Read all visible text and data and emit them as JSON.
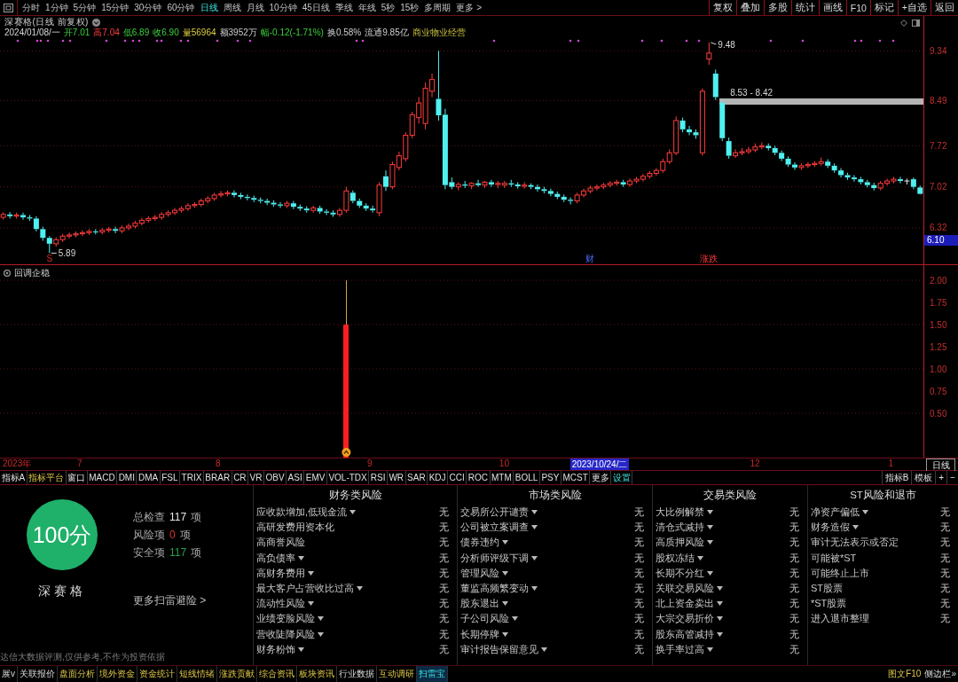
{
  "toolbar": {
    "periods": [
      {
        "label": "分时",
        "selected": false
      },
      {
        "label": "1分钟",
        "selected": false
      },
      {
        "label": "5分钟",
        "selected": false
      },
      {
        "label": "15分钟",
        "selected": false
      },
      {
        "label": "30分钟",
        "selected": false
      },
      {
        "label": "60分钟",
        "selected": false
      },
      {
        "label": "日线",
        "selected": true
      },
      {
        "label": "周线",
        "selected": false
      },
      {
        "label": "月线",
        "selected": false
      },
      {
        "label": "10分钟",
        "selected": false
      },
      {
        "label": "45日线",
        "selected": false
      },
      {
        "label": "季线",
        "selected": false
      },
      {
        "label": "年线",
        "selected": false
      },
      {
        "label": "5秒",
        "selected": false
      },
      {
        "label": "15秒",
        "selected": false
      },
      {
        "label": "多周期",
        "selected": false
      },
      {
        "label": "更多 >",
        "selected": false
      }
    ],
    "buttons": [
      "复权",
      "叠加",
      "多股",
      "统计",
      "画线",
      "F10",
      "标记",
      "+自选",
      "返回"
    ]
  },
  "stock_header": {
    "title": "深赛格(日线 前复权)",
    "date": "2024/01/08/一",
    "quotes": [
      {
        "text": "开7.01",
        "kind": "fall"
      },
      {
        "text": "高7.04",
        "kind": "rise"
      },
      {
        "text": "低6.89",
        "kind": "fall"
      },
      {
        "text": "收6.90",
        "kind": "fall"
      },
      {
        "text": "量56964",
        "kind": "volume"
      },
      {
        "text": "额3952万",
        "kind": "plain"
      },
      {
        "text": "幅-0.12(-1.71%)",
        "kind": "fall"
      },
      {
        "text": "换0.58%",
        "kind": "plain"
      },
      {
        "text": "流通9.85亿",
        "kind": "plain"
      },
      {
        "text": "商业物业经营",
        "kind": "industry"
      }
    ]
  },
  "price_chart": {
    "chart_data": [
      {
        "type": "candlestick",
        "ohlc": [
          [
            6.5,
            6.59,
            6.46,
            6.55
          ],
          [
            6.55,
            6.59,
            6.48,
            6.52
          ],
          [
            6.52,
            6.58,
            6.48,
            6.54
          ],
          [
            6.54,
            6.58,
            6.46,
            6.5
          ],
          [
            6.5,
            6.54,
            6.44,
            6.48
          ],
          [
            6.48,
            6.52,
            6.26,
            6.3
          ],
          [
            6.3,
            6.34,
            6.1,
            6.15
          ],
          [
            6.15,
            6.18,
            5.89,
            6.05
          ],
          [
            6.05,
            6.16,
            6.0,
            6.12
          ],
          [
            6.12,
            6.22,
            6.08,
            6.18
          ],
          [
            6.18,
            6.24,
            6.14,
            6.2
          ],
          [
            6.2,
            6.26,
            6.16,
            6.22
          ],
          [
            6.22,
            6.28,
            6.18,
            6.24
          ],
          [
            6.24,
            6.3,
            6.2,
            6.26
          ],
          [
            6.26,
            6.3,
            6.21,
            6.25
          ],
          [
            6.25,
            6.32,
            6.21,
            6.28
          ],
          [
            6.28,
            6.34,
            6.24,
            6.3
          ],
          [
            6.3,
            6.34,
            6.23,
            6.27
          ],
          [
            6.27,
            6.36,
            6.23,
            6.32
          ],
          [
            6.32,
            6.39,
            6.28,
            6.35
          ],
          [
            6.35,
            6.44,
            6.31,
            6.4
          ],
          [
            6.4,
            6.49,
            6.36,
            6.45
          ],
          [
            6.45,
            6.52,
            6.41,
            6.48
          ],
          [
            6.48,
            6.54,
            6.44,
            6.5
          ],
          [
            6.5,
            6.59,
            6.46,
            6.55
          ],
          [
            6.55,
            6.62,
            6.51,
            6.58
          ],
          [
            6.58,
            6.66,
            6.54,
            6.62
          ],
          [
            6.62,
            6.69,
            6.58,
            6.65
          ],
          [
            6.65,
            6.74,
            6.61,
            6.7
          ],
          [
            6.7,
            6.76,
            6.66,
            6.72
          ],
          [
            6.72,
            6.82,
            6.68,
            6.78
          ],
          [
            6.78,
            6.86,
            6.74,
            6.82
          ],
          [
            6.82,
            6.92,
            6.78,
            6.88
          ],
          [
            6.88,
            6.95,
            6.84,
            6.9
          ],
          [
            6.9,
            6.96,
            6.86,
            6.92
          ],
          [
            6.92,
            6.96,
            6.84,
            6.88
          ],
          [
            6.88,
            6.92,
            6.81,
            6.85
          ],
          [
            6.85,
            6.89,
            6.79,
            6.83
          ],
          [
            6.83,
            6.87,
            6.76,
            6.8
          ],
          [
            6.8,
            6.84,
            6.74,
            6.78
          ],
          [
            6.78,
            6.82,
            6.71,
            6.75
          ],
          [
            6.75,
            6.79,
            6.68,
            6.72
          ],
          [
            6.72,
            6.76,
            6.66,
            6.7
          ],
          [
            6.7,
            6.78,
            6.66,
            6.74
          ],
          [
            6.74,
            6.78,
            6.64,
            6.68
          ],
          [
            6.68,
            6.72,
            6.61,
            6.65
          ],
          [
            6.65,
            6.69,
            6.58,
            6.62
          ],
          [
            6.62,
            6.7,
            6.58,
            6.66
          ],
          [
            6.66,
            6.7,
            6.56,
            6.6
          ],
          [
            6.6,
            6.64,
            6.54,
            6.58
          ],
          [
            6.58,
            6.62,
            6.51,
            6.55
          ],
          [
            6.55,
            6.66,
            6.51,
            6.62
          ],
          [
            6.62,
            7.02,
            6.58,
            6.95
          ],
          [
            6.92,
            6.96,
            6.74,
            6.78
          ],
          [
            6.78,
            6.82,
            6.66,
            6.7
          ],
          [
            6.7,
            6.74,
            6.61,
            6.65
          ],
          [
            6.65,
            6.7,
            6.58,
            6.62
          ],
          [
            6.58,
            7.1,
            6.52,
            7.05
          ],
          [
            7.2,
            7.3,
            6.95,
            7.02
          ],
          [
            7.02,
            7.45,
            6.98,
            7.4
          ],
          [
            7.35,
            7.62,
            7.3,
            7.55
          ],
          [
            7.5,
            7.95,
            7.45,
            7.9
          ],
          [
            7.9,
            8.3,
            7.85,
            8.25
          ],
          [
            8.2,
            8.55,
            8.1,
            8.45
          ],
          [
            8.1,
            8.8,
            8.0,
            8.7
          ],
          [
            8.65,
            8.95,
            8.55,
            8.85
          ],
          [
            8.52,
            9.34,
            8.15,
            8.24
          ],
          [
            8.25,
            8.35,
            6.98,
            7.05
          ],
          [
            7.1,
            7.18,
            6.98,
            7.02
          ],
          [
            7.02,
            7.1,
            6.96,
            7.06
          ],
          [
            7.06,
            7.12,
            7.0,
            7.04
          ],
          [
            7.04,
            7.1,
            6.98,
            7.08
          ],
          [
            7.08,
            7.14,
            7.02,
            7.05
          ],
          [
            7.05,
            7.12,
            7.0,
            7.1
          ],
          [
            7.1,
            7.14,
            7.02,
            7.06
          ],
          [
            7.06,
            7.12,
            7.0,
            7.08
          ],
          [
            7.05,
            7.12,
            7.0,
            7.08
          ],
          [
            7.08,
            7.14,
            7.02,
            7.06
          ],
          [
            7.06,
            7.1,
            6.99,
            7.03
          ],
          [
            7.03,
            7.1,
            6.99,
            7.05
          ],
          [
            7.05,
            7.08,
            6.98,
            7.02
          ],
          [
            7.02,
            7.06,
            6.94,
            6.98
          ],
          [
            6.98,
            7.02,
            6.91,
            6.95
          ],
          [
            6.95,
            6.99,
            6.86,
            6.9
          ],
          [
            6.9,
            6.94,
            6.81,
            6.85
          ],
          [
            6.85,
            6.89,
            6.76,
            6.8
          ],
          [
            6.8,
            6.84,
            6.72,
            6.78
          ],
          [
            6.78,
            6.92,
            6.74,
            6.88
          ],
          [
            6.88,
            6.99,
            6.84,
            6.95
          ],
          [
            6.95,
            7.04,
            6.91,
            7.0
          ],
          [
            7.0,
            7.06,
            6.96,
            7.02
          ],
          [
            7.02,
            7.09,
            6.98,
            7.05
          ],
          [
            7.05,
            7.12,
            7.01,
            7.08
          ],
          [
            7.08,
            7.14,
            7.04,
            7.1
          ],
          [
            7.1,
            7.14,
            7.02,
            7.06
          ],
          [
            7.06,
            7.16,
            7.02,
            7.12
          ],
          [
            7.12,
            7.19,
            7.08,
            7.15
          ],
          [
            7.15,
            7.24,
            7.11,
            7.2
          ],
          [
            7.2,
            7.29,
            7.16,
            7.25
          ],
          [
            7.25,
            7.34,
            7.21,
            7.3
          ],
          [
            7.3,
            7.5,
            7.26,
            7.45
          ],
          [
            7.45,
            7.66,
            7.41,
            7.6
          ],
          [
            7.6,
            8.22,
            7.56,
            8.15
          ],
          [
            8.15,
            8.2,
            7.95,
            8.0
          ],
          [
            8.0,
            8.06,
            7.9,
            7.95
          ],
          [
            7.95,
            8.0,
            7.84,
            7.9
          ],
          [
            7.6,
            8.7,
            7.55,
            8.65
          ],
          [
            9.2,
            9.48,
            9.1,
            9.3
          ],
          [
            8.95,
            9.02,
            8.5,
            8.55
          ],
          [
            8.45,
            8.5,
            7.8,
            7.85
          ],
          [
            7.8,
            7.86,
            7.5,
            7.55
          ],
          [
            7.55,
            7.66,
            7.51,
            7.6
          ],
          [
            7.6,
            7.68,
            7.56,
            7.62
          ],
          [
            7.62,
            7.7,
            7.58,
            7.65
          ],
          [
            7.65,
            7.76,
            7.61,
            7.7
          ],
          [
            7.7,
            7.78,
            7.66,
            7.72
          ],
          [
            7.72,
            7.76,
            7.64,
            7.68
          ],
          [
            7.68,
            7.72,
            7.56,
            7.6
          ],
          [
            7.6,
            7.64,
            7.46,
            7.5
          ],
          [
            7.5,
            7.54,
            7.36,
            7.4
          ],
          [
            7.4,
            7.44,
            7.31,
            7.35
          ],
          [
            7.35,
            7.42,
            7.31,
            7.38
          ],
          [
            7.38,
            7.44,
            7.34,
            7.4
          ],
          [
            7.4,
            7.46,
            7.36,
            7.42
          ],
          [
            7.42,
            7.52,
            7.38,
            7.45
          ],
          [
            7.45,
            7.49,
            7.34,
            7.38
          ],
          [
            7.38,
            7.42,
            7.26,
            7.3
          ],
          [
            7.3,
            7.34,
            7.18,
            7.22
          ],
          [
            7.22,
            7.26,
            7.14,
            7.18
          ],
          [
            7.18,
            7.22,
            7.11,
            7.15
          ],
          [
            7.15,
            7.19,
            7.06,
            7.1
          ],
          [
            7.1,
            7.14,
            7.01,
            7.05
          ],
          [
            7.05,
            7.09,
            6.96,
            7.0
          ],
          [
            7.0,
            7.12,
            6.96,
            7.08
          ],
          [
            7.08,
            7.16,
            7.04,
            7.12
          ],
          [
            7.12,
            7.19,
            7.08,
            7.15
          ],
          [
            7.15,
            7.19,
            7.08,
            7.12
          ],
          [
            7.12,
            7.16,
            7.06,
            7.12
          ],
          [
            7.15,
            7.18,
            6.98,
            7.02
          ],
          [
            7.01,
            7.04,
            6.89,
            6.9
          ]
        ],
        "ylim": [
          5.7,
          9.54
        ],
        "yticks": [
          9.34,
          8.49,
          7.72,
          7.02,
          6.32
        ],
        "tick_labels": "y",
        "grid": true,
        "bands": [
          {
            "axis": "y",
            "from": 8.42,
            "to": 8.53,
            "label": "8.53 - 8.42",
            "color": "#b4b4b4"
          }
        ],
        "annotations": [
          "9.48",
          "5.89"
        ]
      }
    ],
    "event_markers": [
      {
        "label": "S",
        "kind": "signal"
      },
      {
        "label": "财",
        "kind": "report"
      },
      {
        "label": "涨跌",
        "kind": "move"
      }
    ],
    "cursor_price": "6.10"
  },
  "indicator": {
    "chart_data": [
      {
        "type": "bar",
        "title": "回调企稳",
        "categories": [
          "2023年",
          null,
          null,
          null,
          null,
          null,
          null,
          null,
          null,
          null,
          null,
          null,
          "7",
          null,
          null,
          null,
          null,
          null,
          null,
          null,
          null,
          null,
          null,
          null,
          null,
          null,
          null,
          null,
          null,
          null,
          null,
          null,
          null,
          "8",
          null,
          null,
          null,
          null,
          null,
          null,
          null,
          null,
          null,
          null,
          null,
          null,
          null,
          null,
          null,
          null,
          null,
          null,
          null,
          null,
          null,
          null,
          "9",
          null,
          null,
          null,
          null,
          null,
          null,
          null,
          null,
          null,
          null,
          null,
          null,
          null,
          null,
          null,
          null,
          null,
          null,
          null,
          "10",
          null,
          null,
          null,
          null,
          null,
          null,
          null,
          null,
          null,
          null,
          null,
          null,
          null,
          null,
          null,
          null,
          null,
          null,
          null,
          null,
          null,
          null,
          null,
          null,
          null,
          null,
          null,
          null,
          null,
          null,
          null,
          null,
          null,
          null,
          null,
          null,
          null,
          "12",
          null,
          null,
          null,
          null,
          null,
          null,
          null,
          null,
          null,
          null,
          null,
          null,
          null,
          null,
          null,
          null,
          null,
          null,
          null,
          null,
          "1",
          null,
          null,
          null,
          null
        ],
        "stacked": true,
        "series": [
          {
            "color": "#ff1e1e",
            "values": [
              null,
              null,
              null,
              null,
              null,
              null,
              null,
              null,
              null,
              null,
              null,
              null,
              null,
              null,
              null,
              null,
              null,
              null,
              null,
              null,
              null,
              null,
              null,
              null,
              null,
              null,
              null,
              null,
              null,
              null,
              null,
              null,
              null,
              null,
              null,
              null,
              null,
              null,
              null,
              null,
              null,
              null,
              null,
              null,
              null,
              null,
              null,
              null,
              null,
              null,
              null,
              null,
              1.5,
              null,
              null,
              null,
              null,
              null,
              null,
              null,
              null,
              null,
              null,
              null,
              null,
              null,
              null,
              null,
              null,
              null,
              null,
              null,
              null,
              null,
              null,
              null,
              null,
              null,
              null,
              null,
              null,
              null,
              null,
              null,
              null,
              null,
              null,
              null,
              null,
              null,
              null,
              null,
              null,
              null,
              null,
              null,
              null,
              null,
              null,
              null,
              null,
              null,
              null,
              null,
              null,
              null,
              null,
              null,
              null,
              null,
              null,
              null,
              null,
              null,
              null,
              null,
              null,
              null,
              null,
              null,
              null,
              null,
              null,
              null,
              null,
              null,
              null,
              null,
              null,
              null,
              null,
              null,
              null,
              null,
              null,
              null,
              null,
              null,
              null,
              null
            ]
          },
          {
            "color": "#c8a848",
            "values": [
              null,
              null,
              null,
              null,
              null,
              null,
              null,
              null,
              null,
              null,
              null,
              null,
              null,
              null,
              null,
              null,
              null,
              null,
              null,
              null,
              null,
              null,
              null,
              null,
              null,
              null,
              null,
              null,
              null,
              null,
              null,
              null,
              null,
              null,
              null,
              null,
              null,
              null,
              null,
              null,
              null,
              null,
              null,
              null,
              null,
              null,
              null,
              null,
              null,
              null,
              null,
              null,
              0.5,
              null,
              null,
              null,
              null,
              null,
              null,
              null,
              null,
              null,
              null,
              null,
              null,
              null,
              null,
              null,
              null,
              null,
              null,
              null,
              null,
              null,
              null,
              null,
              null,
              null,
              null,
              null,
              null,
              null,
              null,
              null,
              null,
              null,
              null,
              null,
              null,
              null,
              null,
              null,
              null,
              null,
              null,
              null,
              null,
              null,
              null,
              null,
              null,
              null,
              null,
              null,
              null,
              null,
              null,
              null,
              null,
              null,
              null,
              null,
              null,
              null,
              null,
              null,
              null,
              null,
              null,
              null,
              null,
              null,
              null,
              null,
              null,
              null,
              null,
              null,
              null,
              null,
              null,
              null,
              null,
              null,
              null,
              null,
              null,
              null,
              null,
              null
            ]
          }
        ],
        "ylim": [
          0,
          2.18
        ],
        "yticks": [
          {
            "value": 2,
            "label": "2.00"
          },
          {
            "value": 1.75,
            "label": "1.75"
          },
          {
            "value": 1.5,
            "label": "1.50"
          },
          {
            "value": 1.25,
            "label": "1.25"
          },
          {
            "value": 1,
            "label": "1.00"
          },
          {
            "value": 0.75,
            "label": "0.75"
          },
          {
            "value": 0.5,
            "label": "0.50"
          }
        ],
        "grid": true
      }
    ],
    "cursor_date": "2023/10/24/二",
    "period_label": "日线"
  },
  "indicator_tabs": {
    "left": [
      {
        "label": "指标A",
        "kind": "plain"
      },
      {
        "label": "指标平台",
        "kind": "platform"
      },
      {
        "label": "窗口",
        "kind": "plain"
      },
      {
        "label": "MACD",
        "kind": "plain"
      },
      {
        "label": "DMI",
        "kind": "plain"
      },
      {
        "label": "DMA",
        "kind": "plain"
      },
      {
        "label": "FSL",
        "kind": "plain"
      },
      {
        "label": "TRIX",
        "kind": "plain"
      },
      {
        "label": "BRAR",
        "kind": "plain"
      },
      {
        "label": "CR",
        "kind": "plain"
      },
      {
        "label": "VR",
        "kind": "plain"
      },
      {
        "label": "OBV",
        "kind": "plain"
      },
      {
        "label": "ASI",
        "kind": "plain"
      },
      {
        "label": "EMV",
        "kind": "plain"
      },
      {
        "label": "VOL-TDX",
        "kind": "plain"
      },
      {
        "label": "RSI",
        "kind": "plain"
      },
      {
        "label": "WR",
        "kind": "plain"
      },
      {
        "label": "SAR",
        "kind": "plain"
      },
      {
        "label": "KDJ",
        "kind": "plain"
      },
      {
        "label": "CCI",
        "kind": "plain"
      },
      {
        "label": "ROC",
        "kind": "plain"
      },
      {
        "label": "MTM",
        "kind": "plain"
      },
      {
        "label": "BOLL",
        "kind": "plain"
      },
      {
        "label": "PSY",
        "kind": "plain"
      },
      {
        "label": "MCST",
        "kind": "plain"
      },
      {
        "label": "更多",
        "kind": "plain"
      },
      {
        "label": "设置",
        "kind": "settings"
      }
    ],
    "right": [
      "指标B",
      "模板",
      "+",
      "−"
    ]
  },
  "risk_scan": {
    "score": "100分",
    "stock_name": "深赛格",
    "stats": [
      {
        "label": "总检查",
        "value": "117",
        "unit": "项",
        "kind": "total"
      },
      {
        "label": "风险项",
        "value": "0",
        "unit": "项",
        "kind": "risk"
      },
      {
        "label": "安全项",
        "value": "117",
        "unit": "项",
        "kind": "safe"
      }
    ],
    "more_link": "更多扫雷避险 >",
    "disclaimer": "达信大数据评测,仅供参考,不作为投资依据",
    "categories": [
      {
        "title": "财务类风险",
        "items": [
          {
            "label": "应收款增加,低现金流",
            "has_details": true,
            "result": "无"
          },
          {
            "label": "高研发费用资本化",
            "has_details": false,
            "result": "无"
          },
          {
            "label": "高商誉风险",
            "has_details": false,
            "result": "无"
          },
          {
            "label": "高负债率",
            "has_details": true,
            "result": "无"
          },
          {
            "label": "高财务费用",
            "has_details": true,
            "result": "无"
          },
          {
            "label": "最大客户占营收比过高",
            "has_details": true,
            "result": "无"
          },
          {
            "label": "流动性风险",
            "has_details": true,
            "result": "无"
          },
          {
            "label": "业绩变脸风险",
            "has_details": true,
            "result": "无"
          },
          {
            "label": "营收陡降风险",
            "has_details": true,
            "result": "无"
          },
          {
            "label": "财务粉饰",
            "has_details": true,
            "result": "无"
          }
        ]
      },
      {
        "title": "市场类风险",
        "items": [
          {
            "label": "交易所公开谴责",
            "has_details": true,
            "result": "无"
          },
          {
            "label": "公司被立案调查",
            "has_details": true,
            "result": "无"
          },
          {
            "label": "债券违约",
            "has_details": true,
            "result": "无"
          },
          {
            "label": "分析师评级下调",
            "has_details": true,
            "result": "无"
          },
          {
            "label": "管理风险",
            "has_details": true,
            "result": "无"
          },
          {
            "label": "董监高频繁变动",
            "has_details": true,
            "result": "无"
          },
          {
            "label": "股东退出",
            "has_details": true,
            "result": "无"
          },
          {
            "label": "子公司风险",
            "has_details": true,
            "result": "无"
          },
          {
            "label": "长期停牌",
            "has_details": true,
            "result": "无"
          },
          {
            "label": "审计报告保留意见",
            "has_details": true,
            "result": "无"
          }
        ]
      },
      {
        "title": "交易类风险",
        "items": [
          {
            "label": "大比例解禁",
            "has_details": true,
            "result": "无"
          },
          {
            "label": "清仓式减持",
            "has_details": true,
            "result": "无"
          },
          {
            "label": "高质押风险",
            "has_details": true,
            "result": "无"
          },
          {
            "label": "股权冻结",
            "has_details": true,
            "result": "无"
          },
          {
            "label": "长期不分红",
            "has_details": true,
            "result": "无"
          },
          {
            "label": "关联交易风险",
            "has_details": true,
            "result": "无"
          },
          {
            "label": "北上资金卖出",
            "has_details": true,
            "result": "无"
          },
          {
            "label": "大宗交易折价",
            "has_details": true,
            "result": "无"
          },
          {
            "label": "股东高管减持",
            "has_details": true,
            "result": "无"
          },
          {
            "label": "换手率过高",
            "has_details": true,
            "result": "无"
          }
        ]
      },
      {
        "title": "ST风险和退市",
        "items": [
          {
            "label": "净资产偏低",
            "has_details": true,
            "result": "无"
          },
          {
            "label": "财务造假",
            "has_details": true,
            "result": "无"
          },
          {
            "label": "审计无法表示或否定",
            "has_details": false,
            "result": "无"
          },
          {
            "label": "可能被*ST",
            "has_details": false,
            "result": "无"
          },
          {
            "label": "可能终止上市",
            "has_details": false,
            "result": "无"
          },
          {
            "label": "ST股票",
            "has_details": false,
            "result": "无"
          },
          {
            "label": "*ST股票",
            "has_details": false,
            "result": "无"
          },
          {
            "label": "进入退市整理",
            "has_details": false,
            "result": "无"
          }
        ]
      }
    ]
  },
  "bottom_bar": {
    "tabs": [
      {
        "label": "展v",
        "kind": "plain",
        "selected": false
      },
      {
        "label": "关联报价",
        "kind": "plain",
        "selected": false
      },
      {
        "label": "盘面分析",
        "kind": "feature",
        "selected": false
      },
      {
        "label": "境外资金",
        "kind": "feature",
        "selected": false
      },
      {
        "label": "资金统计",
        "kind": "feature",
        "selected": false
      },
      {
        "label": "短线情绪",
        "kind": "feature",
        "selected": false
      },
      {
        "label": "涨跌贡献",
        "kind": "feature",
        "selected": false
      },
      {
        "label": "综合资讯",
        "kind": "feature",
        "selected": false
      },
      {
        "label": "板块资讯",
        "kind": "feature",
        "selected": false
      },
      {
        "label": "行业数据",
        "kind": "plain",
        "selected": false
      },
      {
        "label": "互动调研",
        "kind": "feature",
        "selected": false
      },
      {
        "label": "扫雷宝",
        "kind": "feature",
        "selected": true
      }
    ],
    "right": [
      {
        "label": "图文F10",
        "kind": "feature"
      },
      {
        "label": "侧边栏»",
        "kind": "plain"
      }
    ]
  }
}
